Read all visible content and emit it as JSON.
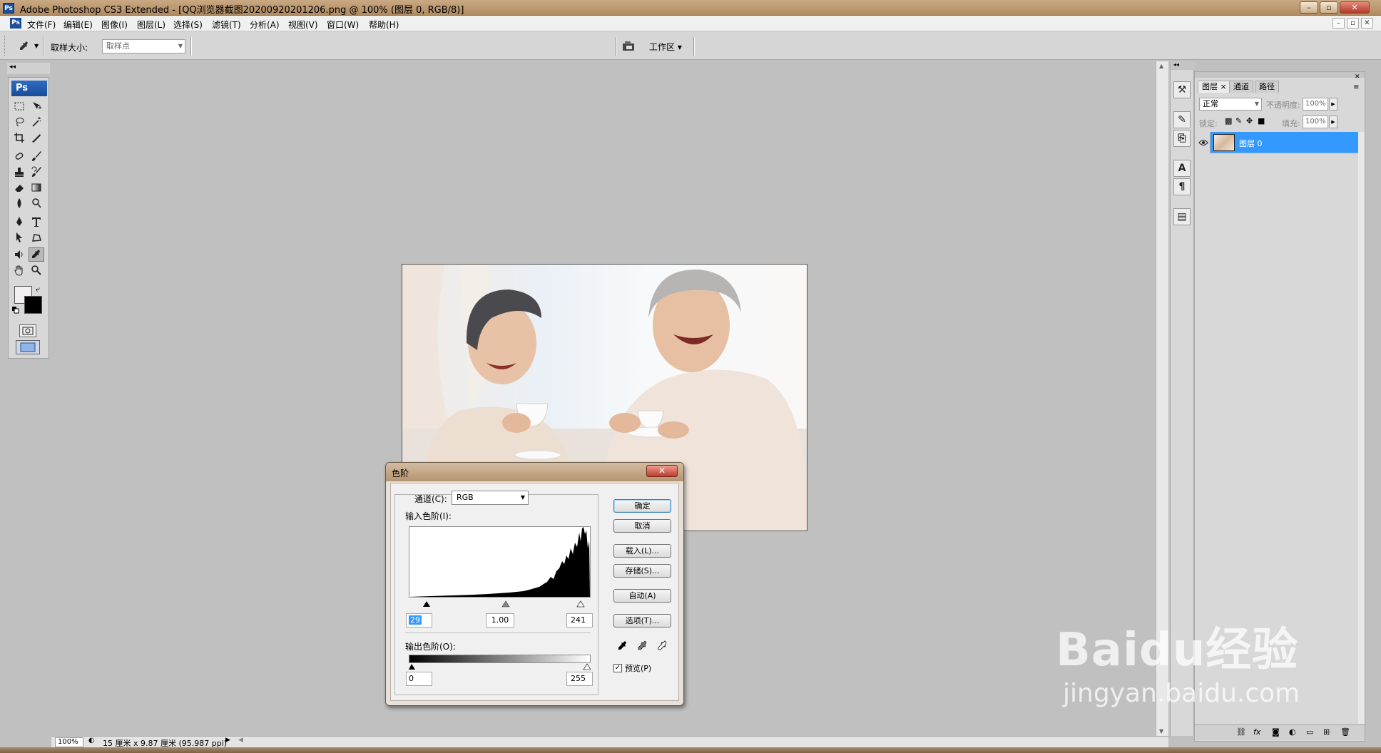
{
  "window": {
    "title": "Adobe Photoshop CS3 Extended - [QQ浏览器截图20200920201206.png @ 100% (图层 0, RGB/8)]",
    "app_icon": "Ps"
  },
  "menu": {
    "items": [
      "文件(F)",
      "编辑(E)",
      "图像(I)",
      "图层(L)",
      "选择(S)",
      "滤镜(T)",
      "分析(A)",
      "视图(V)",
      "窗口(W)",
      "帮助(H)"
    ]
  },
  "options_bar": {
    "sample_size_label": "取样大小:",
    "sample_size_value": "取样点",
    "workspace_label": "工作区 ▾"
  },
  "toolbox": {
    "logo": "Ps"
  },
  "status_bar": {
    "zoom": "100%",
    "doc_info": "15 厘米 x 9.87 厘米 (95.987 ppi)"
  },
  "layers_panel": {
    "tabs": [
      {
        "label": "图层 ×",
        "active": true
      },
      {
        "label": "通道",
        "active": false
      },
      {
        "label": "路径",
        "active": false
      }
    ],
    "blend_mode": "正常",
    "opacity_label": "不透明度:",
    "opacity_value": "100%",
    "lock_label": "锁定:",
    "fill_label": "填充:",
    "fill_value": "100%",
    "layer_name": "图层 0"
  },
  "levels_dialog": {
    "title": "色阶",
    "channel_label": "通道(C):",
    "channel_value": "RGB",
    "input_levels_label": "输入色阶(I):",
    "input_black": "29",
    "input_gamma": "1.00",
    "input_white": "241",
    "output_levels_label": "输出色阶(O):",
    "output_black": "0",
    "output_white": "255",
    "buttons": {
      "ok": "确定",
      "cancel": "取消",
      "load": "载入(L)...",
      "save": "存储(S)...",
      "auto": "自动(A)",
      "options": "选项(T)..."
    },
    "preview_label": "预览(P)",
    "preview_checked": true
  },
  "watermark": {
    "logo": "Baidu经验",
    "url": "jingyan.baidu.com"
  },
  "colors": {
    "accent": "#3399ff",
    "titlebar": "#b08b62",
    "foreground_color": "#f2f0f0",
    "background_color": "#000000"
  }
}
